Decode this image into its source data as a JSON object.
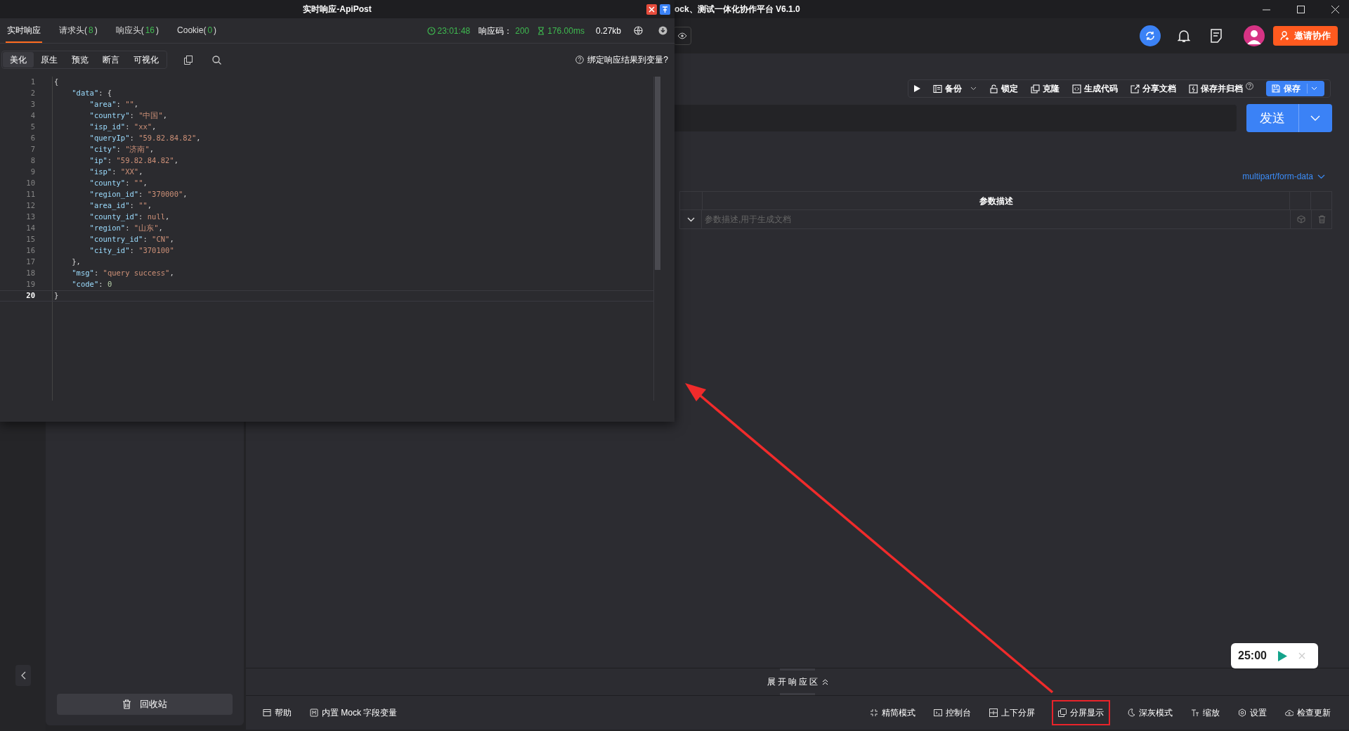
{
  "app": {
    "title": "ock、测试一体化协作平台 V6.1.0",
    "invite_button": "邀请协作",
    "toolbar": [
      {
        "label": "备份",
        "dropdown": true,
        "help": false
      },
      {
        "label": "锁定",
        "dropdown": false,
        "help": false
      },
      {
        "label": "克隆",
        "dropdown": false,
        "help": false
      },
      {
        "label": "生成代码",
        "dropdown": false,
        "help": false
      },
      {
        "label": "分享文档",
        "dropdown": false,
        "help": false
      },
      {
        "label": "保存并归档",
        "dropdown": false,
        "help": true
      }
    ],
    "save_button": "保存",
    "send_button": "发送",
    "body_type": "multipart/form-data",
    "table": {
      "columns": [
        "参数描述"
      ],
      "rows": [
        {
          "description_placeholder": "参数描述,用于生成文档"
        }
      ]
    },
    "expand_bar": "展开响应区",
    "recycle_button": "回收站",
    "status_left": [
      {
        "label": "帮助"
      },
      {
        "label": "内置 Mock 字段变量"
      }
    ],
    "status_right": [
      {
        "label": "精简模式",
        "highlighted": false
      },
      {
        "label": "控制台",
        "highlighted": false
      },
      {
        "label": "上下分屏",
        "highlighted": false
      },
      {
        "label": "分屏显示",
        "highlighted": true
      },
      {
        "label": "深灰模式",
        "highlighted": false
      },
      {
        "label": "缩放",
        "highlighted": false
      },
      {
        "label": "设置",
        "highlighted": false
      },
      {
        "label": "检查更新",
        "highlighted": false
      }
    ],
    "timer": "25:00"
  },
  "popup": {
    "title": "实时响应-ApiPost",
    "tabs": [
      {
        "label": "实时响应",
        "selected": true
      },
      {
        "label": "请求头(",
        "count": "8",
        "close": ")",
        "selected": false
      },
      {
        "label": "响应头(",
        "count": "16",
        "close": ")",
        "selected": false
      },
      {
        "label": "Cookie(",
        "count": "0",
        "close": ")",
        "selected": false
      }
    ],
    "stats": {
      "time": "23:01:48",
      "code_label": "响应码：",
      "code": "200",
      "duration": "176.00ms",
      "size": "0.27kb"
    },
    "view_tabs": [
      {
        "label": "美化",
        "selected": true
      },
      {
        "label": "原生",
        "selected": false
      },
      {
        "label": "预览",
        "selected": false
      },
      {
        "label": "断言",
        "selected": false
      },
      {
        "label": "可视化",
        "selected": false
      }
    ],
    "bind_link": "绑定响应结果到变量?",
    "code_lines": [
      {
        "number": "1",
        "current": false,
        "tokens": [
          {
            "kind": "punct",
            "t": "{"
          }
        ]
      },
      {
        "number": "2",
        "current": false,
        "tokens": [
          {
            "kind": "key",
            "t": "    \"data\""
          },
          {
            "kind": "punct",
            "t": ": {"
          }
        ]
      },
      {
        "number": "3",
        "current": false,
        "tokens": [
          {
            "kind": "key",
            "t": "        \"area\""
          },
          {
            "kind": "punct",
            "t": ": "
          },
          {
            "kind": "string",
            "t": "\"\""
          },
          {
            "kind": "punct",
            "t": ","
          }
        ]
      },
      {
        "number": "4",
        "current": false,
        "tokens": [
          {
            "kind": "key",
            "t": "        \"country\""
          },
          {
            "kind": "punct",
            "t": ": "
          },
          {
            "kind": "string",
            "t": "\"中国\""
          },
          {
            "kind": "punct",
            "t": ","
          }
        ]
      },
      {
        "number": "5",
        "current": false,
        "tokens": [
          {
            "kind": "key",
            "t": "        \"isp_id\""
          },
          {
            "kind": "punct",
            "t": ": "
          },
          {
            "kind": "string",
            "t": "\"xx\""
          },
          {
            "kind": "punct",
            "t": ","
          }
        ]
      },
      {
        "number": "6",
        "current": false,
        "tokens": [
          {
            "kind": "key",
            "t": "        \"queryIp\""
          },
          {
            "kind": "punct",
            "t": ": "
          },
          {
            "kind": "string",
            "t": "\"59.82.84.82\""
          },
          {
            "kind": "punct",
            "t": ","
          }
        ]
      },
      {
        "number": "7",
        "current": false,
        "tokens": [
          {
            "kind": "key",
            "t": "        \"city\""
          },
          {
            "kind": "punct",
            "t": ": "
          },
          {
            "kind": "string",
            "t": "\"济南\""
          },
          {
            "kind": "punct",
            "t": ","
          }
        ]
      },
      {
        "number": "8",
        "current": false,
        "tokens": [
          {
            "kind": "key",
            "t": "        \"ip\""
          },
          {
            "kind": "punct",
            "t": ": "
          },
          {
            "kind": "string",
            "t": "\"59.82.84.82\""
          },
          {
            "kind": "punct",
            "t": ","
          }
        ]
      },
      {
        "number": "9",
        "current": false,
        "tokens": [
          {
            "kind": "key",
            "t": "        \"isp\""
          },
          {
            "kind": "punct",
            "t": ": "
          },
          {
            "kind": "string",
            "t": "\"XX\""
          },
          {
            "kind": "punct",
            "t": ","
          }
        ]
      },
      {
        "number": "10",
        "current": false,
        "tokens": [
          {
            "kind": "key",
            "t": "        \"county\""
          },
          {
            "kind": "punct",
            "t": ": "
          },
          {
            "kind": "string",
            "t": "\"\""
          },
          {
            "kind": "punct",
            "t": ","
          }
        ]
      },
      {
        "number": "11",
        "current": false,
        "tokens": [
          {
            "kind": "key",
            "t": "        \"region_id\""
          },
          {
            "kind": "punct",
            "t": ": "
          },
          {
            "kind": "string",
            "t": "\"370000\""
          },
          {
            "kind": "punct",
            "t": ","
          }
        ]
      },
      {
        "number": "12",
        "current": false,
        "tokens": [
          {
            "kind": "key",
            "t": "        \"area_id\""
          },
          {
            "kind": "punct",
            "t": ": "
          },
          {
            "kind": "string",
            "t": "\"\""
          },
          {
            "kind": "punct",
            "t": ","
          }
        ]
      },
      {
        "number": "13",
        "current": false,
        "tokens": [
          {
            "kind": "key",
            "t": "        \"county_id\""
          },
          {
            "kind": "punct",
            "t": ": "
          },
          {
            "kind": "null",
            "t": "null"
          },
          {
            "kind": "punct",
            "t": ","
          }
        ]
      },
      {
        "number": "14",
        "current": false,
        "tokens": [
          {
            "kind": "key",
            "t": "        \"region\""
          },
          {
            "kind": "punct",
            "t": ": "
          },
          {
            "kind": "string",
            "t": "\"山东\""
          },
          {
            "kind": "punct",
            "t": ","
          }
        ]
      },
      {
        "number": "15",
        "current": false,
        "tokens": [
          {
            "kind": "key",
            "t": "        \"country_id\""
          },
          {
            "kind": "punct",
            "t": ": "
          },
          {
            "kind": "string",
            "t": "\"CN\""
          },
          {
            "kind": "punct",
            "t": ","
          }
        ]
      },
      {
        "number": "16",
        "current": false,
        "tokens": [
          {
            "kind": "key",
            "t": "        \"city_id\""
          },
          {
            "kind": "punct",
            "t": ": "
          },
          {
            "kind": "string",
            "t": "\"370100\""
          }
        ]
      },
      {
        "number": "17",
        "current": false,
        "tokens": [
          {
            "kind": "punct",
            "t": "    },"
          }
        ]
      },
      {
        "number": "18",
        "current": false,
        "tokens": [
          {
            "kind": "key",
            "t": "    \"msg\""
          },
          {
            "kind": "punct",
            "t": ": "
          },
          {
            "kind": "string",
            "t": "\"query success\""
          },
          {
            "kind": "punct",
            "t": ","
          }
        ]
      },
      {
        "number": "19",
        "current": false,
        "tokens": [
          {
            "kind": "key",
            "t": "    \"code\""
          },
          {
            "kind": "punct",
            "t": ": "
          },
          {
            "kind": "number",
            "t": "0"
          }
        ]
      },
      {
        "number": "20",
        "current": true,
        "tokens": [
          {
            "kind": "punct",
            "t": "}"
          }
        ]
      }
    ]
  }
}
